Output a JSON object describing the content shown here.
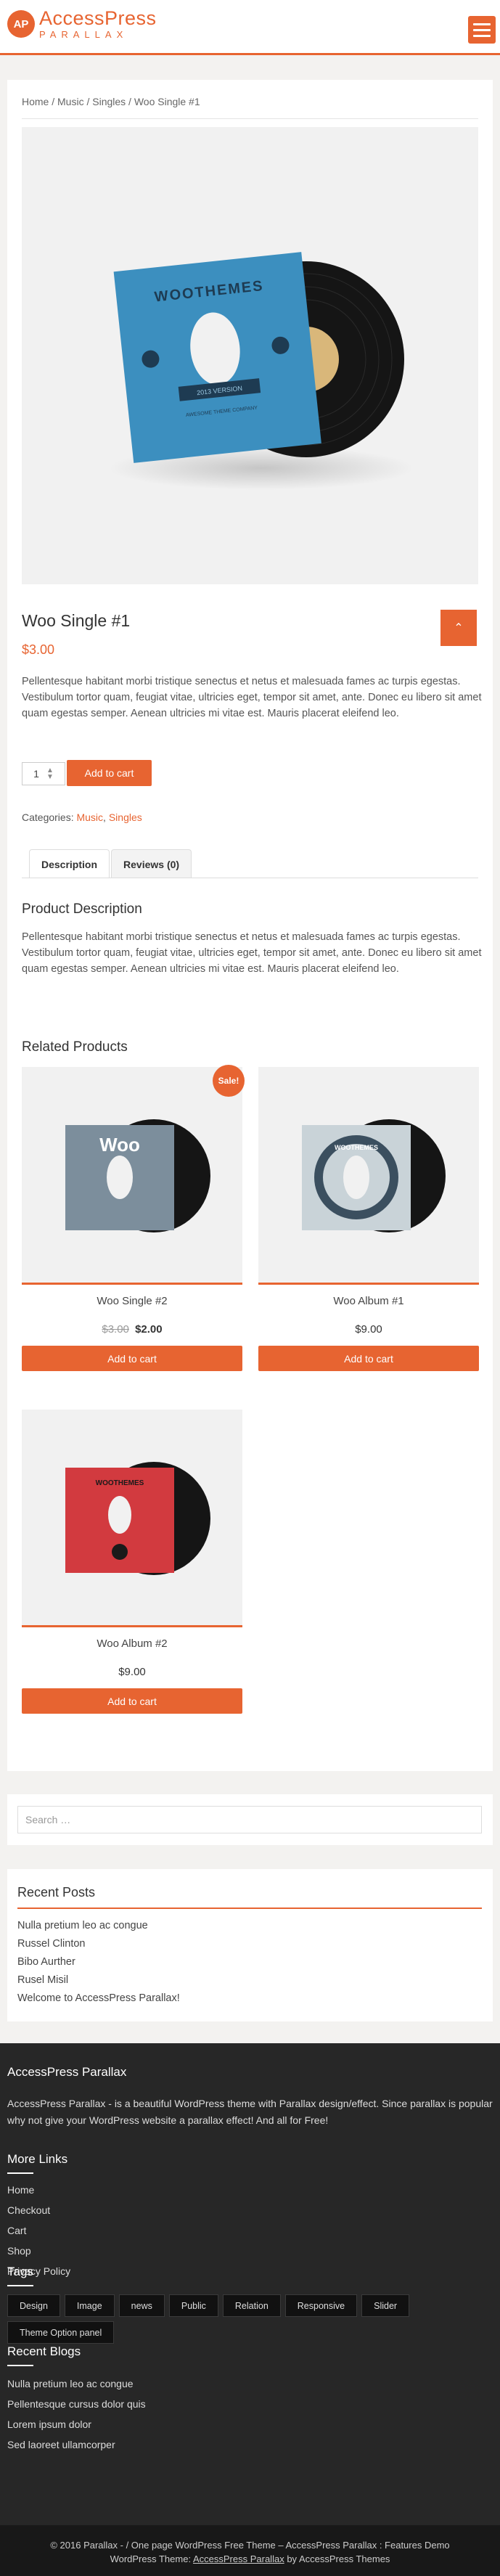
{
  "header": {
    "logo_badge": "AP",
    "logo_title": "AccessPress",
    "logo_subtitle": "PARALLAX"
  },
  "breadcrumb": "Home / Music / Singles / Woo Single #1",
  "product": {
    "image_text_top": "WOOTHEMES",
    "image_text_banner": "2013 VERSION",
    "image_text_company": "AWESOME THEME COMPANY",
    "title": "Woo Single #1",
    "price": "$3.00",
    "short_description": "Pellentesque habitant morbi tristique senectus et netus et malesuada fames ac turpis egestas. Vestibulum tortor quam, feugiat vitae, ultricies eget, tempor sit amet, ante. Donec eu libero sit amet quam egestas semper. Aenean ultricies mi vitae est. Mauris placerat eleifend leo.",
    "quantity": "1",
    "add_to_cart": "Add to cart",
    "categories_label": "Categories:",
    "category_1": "Music",
    "category_sep": ",",
    "category_2": "Singles"
  },
  "tabs": [
    {
      "label": "Description"
    },
    {
      "label": "Reviews (0)"
    }
  ],
  "description": {
    "heading": "Product Description",
    "body": "Pellentesque habitant morbi tristique senectus et netus et malesuada fames ac turpis egestas. Vestibulum tortor quam, feugiat vitae, ultricies eget, tempor sit amet, ante. Donec eu libero sit amet quam egestas semper. Aenean ultricies mi vitae est. Mauris placerat eleifend leo."
  },
  "related": {
    "heading": "Related Products",
    "items": [
      {
        "name": "Woo Single #2",
        "old_price": "$3.00",
        "price": "$2.00",
        "sale": "Sale!",
        "button": "Add to cart",
        "sleeve_text": "Woo",
        "sleeve_color": "#6e7f8c"
      },
      {
        "name": "Woo Album #1",
        "price": "$9.00",
        "button": "Add to cart",
        "sleeve_text": "WOOTHEMES",
        "sleeve_color": "#c8d2d6"
      },
      {
        "name": "Woo Album #2",
        "price": "$9.00",
        "button": "Add to cart",
        "sleeve_text": "WOOTHEMES",
        "sleeve_color": "#d23a3f"
      }
    ]
  },
  "search": {
    "placeholder": "Search …"
  },
  "recent_posts": {
    "title": "Recent Posts",
    "items": [
      "Nulla pretium leo ac congue",
      "Russel Clinton",
      "Bibo Aurther",
      "Rusel Misil",
      "Welcome to AccessPress Parallax!"
    ]
  },
  "footer": {
    "about_title": "AccessPress Parallax",
    "about_text": "AccessPress Parallax - is a beautiful WordPress theme with Parallax design/effect. Since parallax is popular why not give your WordPress website a parallax effect! And all for Free!",
    "more_links_title": "More Links",
    "links": [
      "Home",
      "Checkout",
      "Cart",
      "Shop",
      "Privacy Policy"
    ],
    "tags_title": "Tags",
    "tags": [
      "Design",
      "Image",
      "news",
      "Public",
      "Relation",
      "Responsive",
      "Slider",
      "Theme Option panel"
    ],
    "blogs_title": "Recent Blogs",
    "blogs": [
      "Nulla pretium leo ac congue",
      "Pellentesque cursus dolor quis",
      "Lorem ipsum dolor",
      "Sed laoreet ullamcorper"
    ],
    "copyright": "© 2016 Parallax - / One page WordPress Free Theme – AccessPress Parallax : Features Demo",
    "theme_prefix": "WordPress Theme:",
    "theme_link": "AccessPress Parallax",
    "theme_suffix": "by AccessPress Themes"
  },
  "colors": {
    "accent": "#e76431",
    "footer_bg": "#272727"
  }
}
